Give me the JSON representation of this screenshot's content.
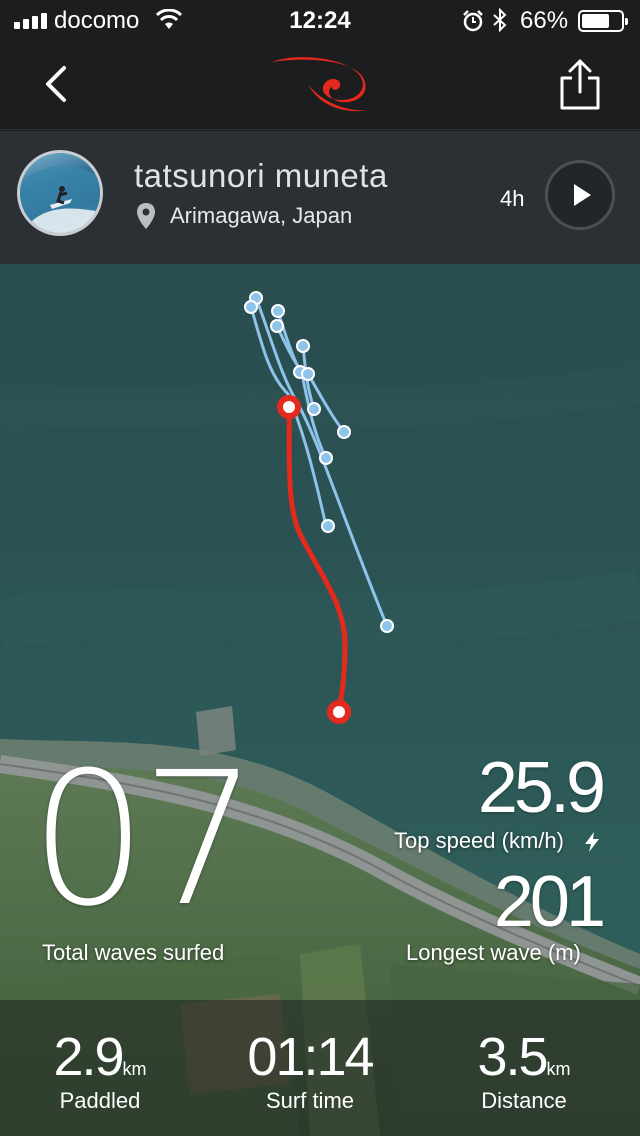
{
  "status_bar": {
    "carrier": "docomo",
    "time": "12:24",
    "battery_percent": "66%",
    "battery_level": 0.66
  },
  "nav": {
    "back_icon": "chevron-left-icon",
    "logo_icon": "ripcurl-logo",
    "share_icon": "share-icon"
  },
  "profile": {
    "name": "tatsunori muneta",
    "location": "Arimagawa, Japan",
    "time_ago": "4h"
  },
  "colors": {
    "accent_red": "#e5291c",
    "track_blue": "#8ec3ea",
    "panel_dark": "#1c1d1f"
  },
  "stats": {
    "total_waves": "07",
    "total_waves_label": "Total waves surfed",
    "top_speed": "25.9",
    "top_speed_label": "Top speed (km/h)",
    "longest_wave": "201",
    "longest_wave_label": "Longest wave (m)",
    "paddled": "2.9",
    "paddled_unit": "km",
    "paddled_label": "Paddled",
    "surf_time": "01:14",
    "surf_time_label": "Surf time",
    "distance": "3.5",
    "distance_unit": "km",
    "distance_label": "Distance"
  }
}
